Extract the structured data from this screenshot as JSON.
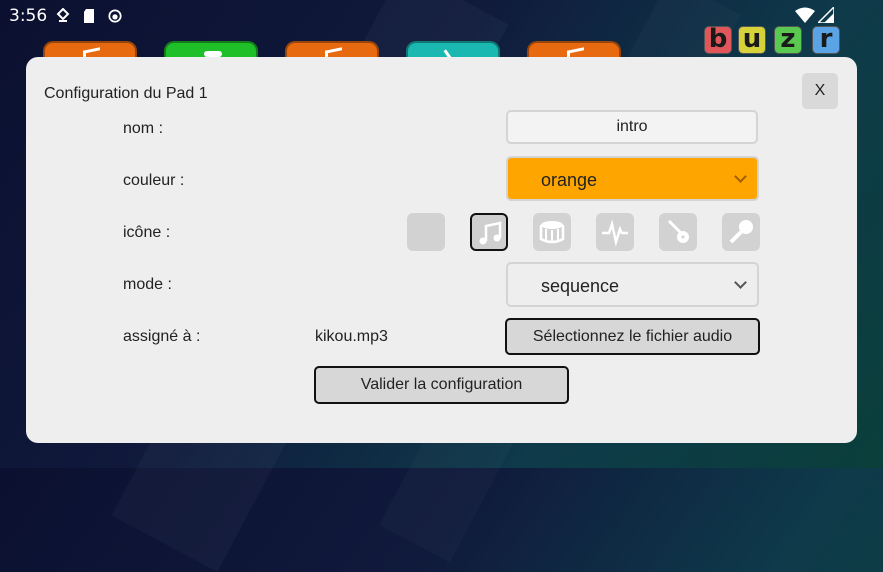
{
  "statusbar": {
    "time": "3:56"
  },
  "logo": {
    "letters": [
      "b",
      "u",
      "z",
      "r"
    ]
  },
  "dialog": {
    "title": "Configuration du Pad 1",
    "close_label": "X",
    "fields": {
      "name_label": "nom :",
      "name_value": "intro",
      "color_label": "couleur :",
      "color_value": "orange",
      "icon_label": "icône :",
      "icon_options": [
        "none",
        "music-note",
        "drum",
        "waveform",
        "guitar",
        "microphone"
      ],
      "icon_selected": "music-note",
      "mode_label": "mode :",
      "mode_value": "sequence",
      "assigned_label": "assigné à :",
      "assigned_value": "kikou.mp3"
    },
    "select_file_button": "Sélectionnez le fichier audio",
    "validate_button": "Valider la configuration"
  },
  "colors": {
    "accent_orange": "#ffa500",
    "pad_orange": "#e86a10",
    "pad_green": "#1fbf2a",
    "pad_teal": "#1ab8b0"
  }
}
